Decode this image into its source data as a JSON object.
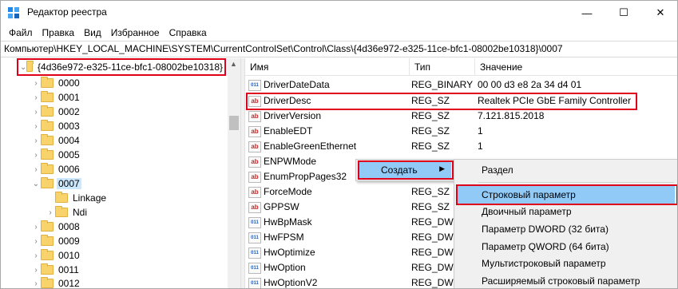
{
  "window": {
    "title": "Редактор реестра",
    "controls": {
      "minimize": "—",
      "maximize": "☐",
      "close": "✕"
    }
  },
  "menu": [
    "Файл",
    "Правка",
    "Вид",
    "Избранное",
    "Справка"
  ],
  "address": "Компьютер\\HKEY_LOCAL_MACHINE\\SYSTEM\\CurrentControlSet\\Control\\Class\\{4d36e972-e325-11ce-bfc1-08002be10318}\\0007",
  "tree": {
    "parent": "{4d36e972-e325-11ce-bfc1-08002be10318}",
    "items": [
      "0000",
      "0001",
      "0002",
      "0003",
      "0004",
      "0005",
      "0006",
      "0007",
      "Linkage",
      "Ndi",
      "0008",
      "0009",
      "0010",
      "0011",
      "0012"
    ]
  },
  "list": {
    "headers": {
      "name": "Имя",
      "type": "Тип",
      "value": "Значение"
    },
    "rows": [
      {
        "name": "DriverDateData",
        "type": "REG_BINARY",
        "value": "00 00 d3 e8 2a 34 d4 01",
        "icon": "binary-value-icon"
      },
      {
        "name": "DriverDesc",
        "type": "REG_SZ",
        "value": "Realtek PCIe GbE Family Controller",
        "icon": "string-value-icon"
      },
      {
        "name": "DriverVersion",
        "type": "REG_SZ",
        "value": "7.121.815.2018",
        "icon": "string-value-icon"
      },
      {
        "name": "EnableEDT",
        "type": "REG_SZ",
        "value": "1",
        "icon": "string-value-icon"
      },
      {
        "name": "EnableGreenEthernet",
        "type": "REG_SZ",
        "value": "1",
        "icon": "string-value-icon"
      },
      {
        "name": "ENPWMode",
        "type": "",
        "value": "",
        "icon": "string-value-icon"
      },
      {
        "name": "EnumPropPages32",
        "type": "",
        "value": "",
        "icon": "string-value-icon"
      },
      {
        "name": "ForceMode",
        "type": "REG_SZ",
        "value": "",
        "icon": "string-value-icon"
      },
      {
        "name": "GPPSW",
        "type": "REG_SZ",
        "value": "",
        "icon": "string-value-icon"
      },
      {
        "name": "HwBpMask",
        "type": "REG_DWO",
        "value": "",
        "icon": "binary-value-icon"
      },
      {
        "name": "HwFPSM",
        "type": "REG_DWO",
        "value": "",
        "icon": "binary-value-icon"
      },
      {
        "name": "HwOptimize",
        "type": "REG_DWO",
        "value": "",
        "icon": "binary-value-icon"
      },
      {
        "name": "HwOption",
        "type": "REG_DWO",
        "value": "",
        "icon": "binary-value-icon"
      },
      {
        "name": "HwOptionV2",
        "type": "REG_DWO",
        "value": "",
        "icon": "binary-value-icon"
      }
    ]
  },
  "context_menu": {
    "create": "Создать",
    "submenu": [
      "Раздел",
      "Строковый параметр",
      "Двоичный параметр",
      "Параметр DWORD (32 бита)",
      "Параметр QWORD (64 бита)",
      "Мультистроковый параметр",
      "Расширяемый строковый параметр"
    ]
  },
  "icon_glyphs": {
    "string": "ab",
    "binary": "011"
  },
  "colors": {
    "highlight_border": "#e0001b",
    "menu_hover": "#91c9f7",
    "tree_selection": "#cce8ff"
  }
}
